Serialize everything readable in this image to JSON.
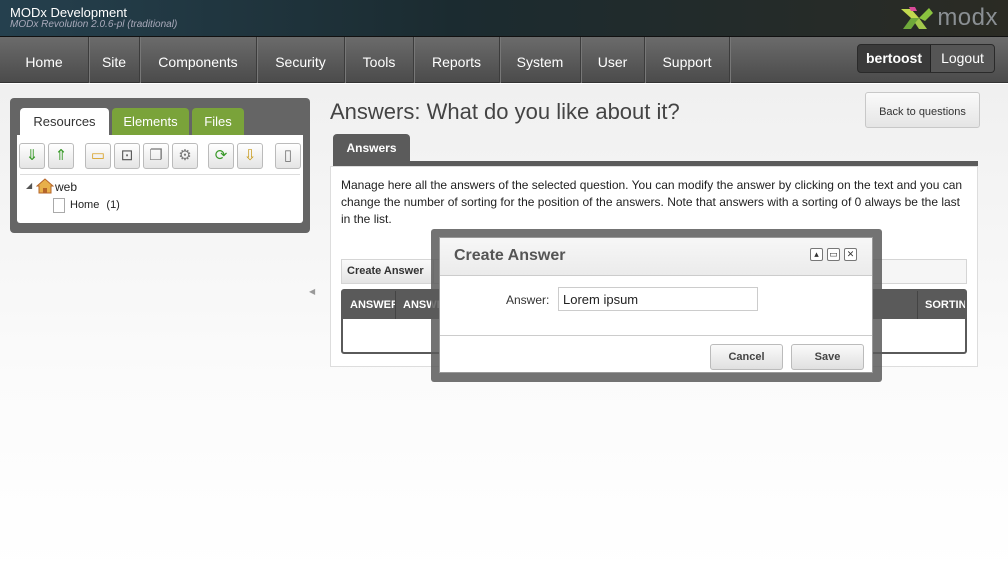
{
  "header": {
    "site_name": "MODx Development",
    "version": "MODx Revolution 2.0.6-pl (traditional)",
    "logo_text": "modx"
  },
  "nav": {
    "items": [
      "Home",
      "Site",
      "Components",
      "Security",
      "Tools",
      "Reports",
      "System",
      "User",
      "Support"
    ],
    "username": "bertoost",
    "logout": "Logout"
  },
  "left_panel": {
    "tabs": [
      "Resources",
      "Elements",
      "Files"
    ],
    "active_tab": "Resources",
    "tree": {
      "root": "web",
      "child": "Home",
      "child_id": "(1)"
    },
    "toolbar_icons": [
      "arrow-down-icon",
      "arrow-up-icon",
      "new-folder-icon",
      "new-weblink-icon",
      "new-symlink-icon",
      "new-static-icon",
      "refresh-icon",
      "sort-icon",
      "trash-icon"
    ]
  },
  "content": {
    "title": "Answers: What do you like about it?",
    "back_button": "Back to questions",
    "tab": "Answers",
    "description": "Manage here all the answers of the selected question. You can modify the answer by clicking on the text and you can change the number of sorting for the position of the answers. Note that answers with a sorting of 0 always be the last in the list.",
    "create_button": "Create Answer",
    "grid_headers": [
      "ANSWER",
      "ANSWER",
      "SORTING"
    ]
  },
  "modal": {
    "title": "Create Answer",
    "field_label": "Answer:",
    "field_value": "Lorem ipsum",
    "cancel": "Cancel",
    "save": "Save"
  },
  "colors": {
    "nav_bg": "#5a5a5a",
    "tab_green": "#7aa33a",
    "panel_dark": "#656565"
  }
}
